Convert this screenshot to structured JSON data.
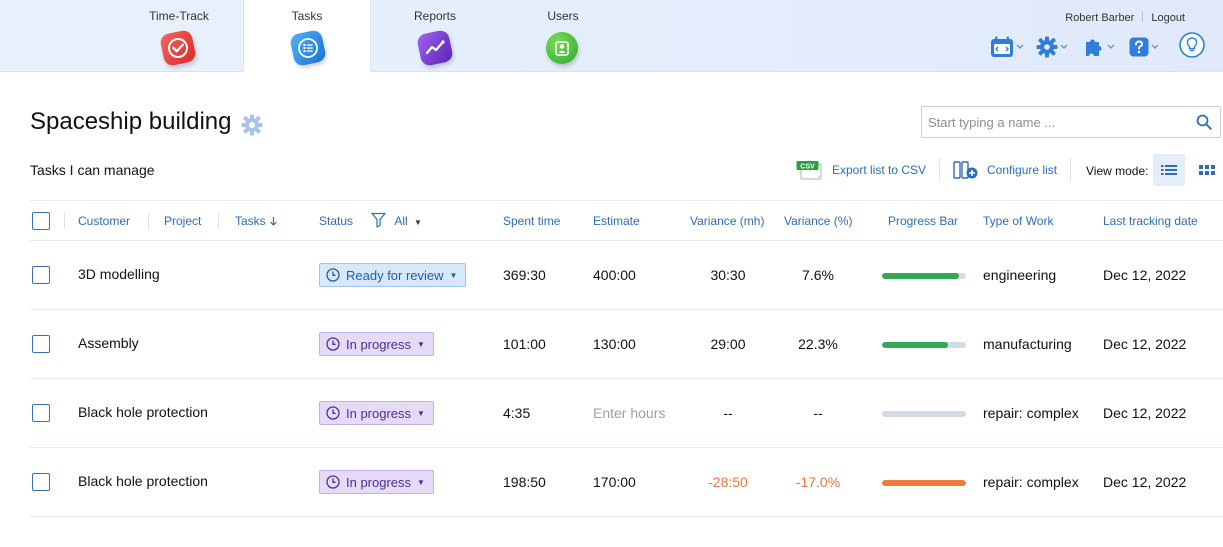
{
  "nav": {
    "tabs": [
      {
        "label": "Time-Track",
        "icon": "checkmark-icon",
        "color": "#e8413c",
        "active": false
      },
      {
        "label": "Tasks",
        "icon": "list-icon",
        "color": "#2d8ae6",
        "active": true
      },
      {
        "label": "Reports",
        "icon": "chart-icon",
        "color": "#7b3fd6",
        "active": false
      },
      {
        "label": "Users",
        "icon": "user-icon",
        "color": "#3fb53a",
        "active": false
      }
    ],
    "user_name": "Robert Barber",
    "logout": "Logout",
    "tools": [
      "calendar-icon",
      "gear-icon",
      "puzzle-icon",
      "help-icon",
      "lightbulb-icon"
    ]
  },
  "page": {
    "title": "Spaceship building",
    "subtitle": "Tasks I can manage",
    "search_placeholder": "Start typing a name ...",
    "export_label": "Export list to CSV",
    "export_badge": "CSV",
    "configure_label": "Configure list",
    "view_mode_label": "View mode:"
  },
  "table": {
    "headers": {
      "customer": "Customer",
      "project": "Project",
      "tasks": "Tasks",
      "status": "Status",
      "filter": "All",
      "spent": "Spent time",
      "estimate": "Estimate",
      "variance_mh": "Variance (mh)",
      "variance_pct": "Variance (%)",
      "progress": "Progress Bar",
      "type": "Type of Work",
      "last_date": "Last tracking date"
    },
    "rows": [
      {
        "task": "3D modelling",
        "status": "Ready for review",
        "status_kind": "review",
        "spent": "369:30",
        "estimate": "400:00",
        "estimate_placeholder": false,
        "var_mh": "30:30",
        "var_pct": "7.6%",
        "negative": false,
        "progress": 0.92,
        "progress_color": "#34a853",
        "type": "engineering",
        "date": "Dec 12, 2022"
      },
      {
        "task": "Assembly",
        "status": "In progress",
        "status_kind": "progress",
        "spent": "101:00",
        "estimate": "130:00",
        "estimate_placeholder": false,
        "var_mh": "29:00",
        "var_pct": "22.3%",
        "negative": false,
        "progress": 0.78,
        "progress_color": "#34a853",
        "type": "manufacturing",
        "date": "Dec 12, 2022"
      },
      {
        "task": "Black hole protection",
        "status": "In progress",
        "status_kind": "progress",
        "spent": "4:35",
        "estimate": "Enter hours",
        "estimate_placeholder": true,
        "var_mh": "--",
        "var_pct": "--",
        "negative": false,
        "progress": 0,
        "progress_color": "#34a853",
        "type": "repair: complex",
        "date": "Dec 12, 2022"
      },
      {
        "task": "Black hole protection",
        "status": "In progress",
        "status_kind": "progress",
        "spent": "198:50",
        "estimate": "170:00",
        "estimate_placeholder": false,
        "var_mh": "-28:50",
        "var_pct": "-17.0%",
        "negative": true,
        "progress": 1.0,
        "progress_color": "#ee7c3c",
        "type": "repair: complex",
        "date": "Dec 12, 2022"
      }
    ]
  }
}
